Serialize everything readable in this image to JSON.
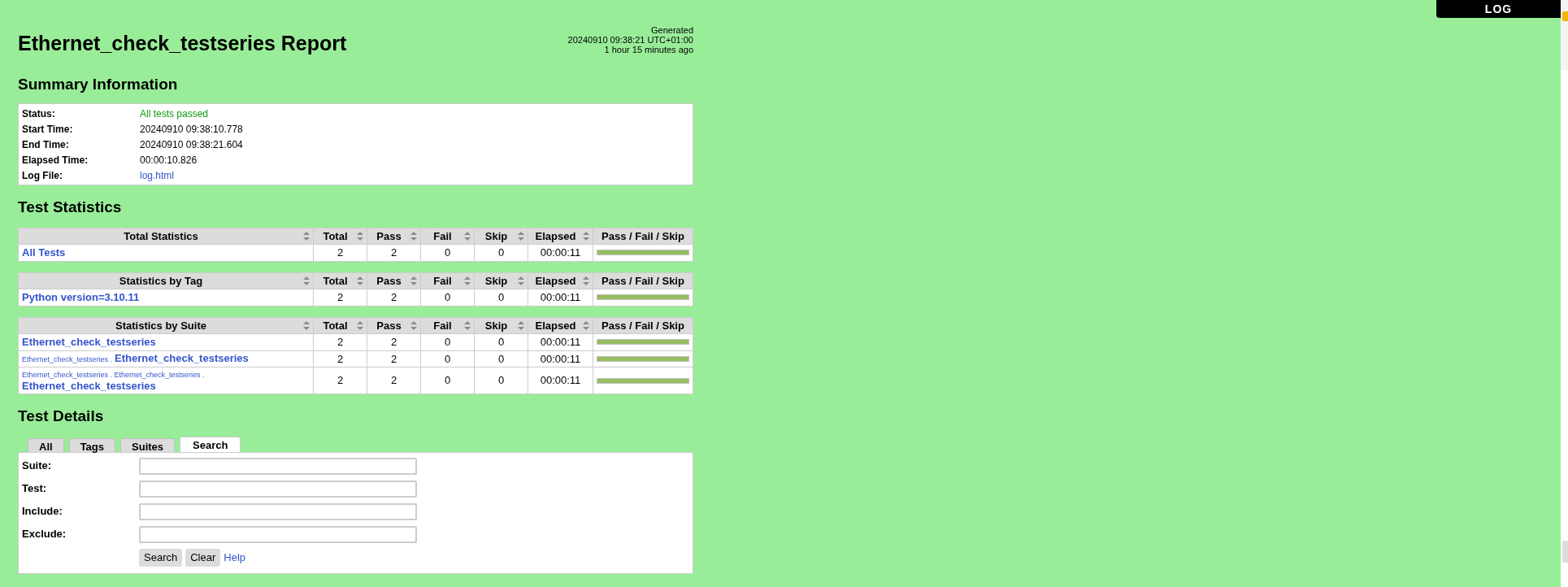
{
  "header": {
    "title": "Ethernet_check_testseries Report",
    "generated": [
      "Generated",
      "20240910 09:38:21 UTC+01:00",
      "1 hour 15 minutes ago"
    ]
  },
  "log_tab": {
    "label": "LOG"
  },
  "summary": {
    "heading": "Summary Information",
    "rows": [
      {
        "label": "Status:",
        "value": "All tests passed",
        "kind": "status"
      },
      {
        "label": "Start Time:",
        "value": "20240910 09:38:10.778",
        "kind": "text"
      },
      {
        "label": "End Time:",
        "value": "20240910 09:38:21.604",
        "kind": "text"
      },
      {
        "label": "Elapsed Time:",
        "value": "00:00:10.826",
        "kind": "text"
      },
      {
        "label": "Log File:",
        "value": "log.html",
        "kind": "link"
      }
    ]
  },
  "statistics": {
    "heading": "Test Statistics",
    "tables": [
      {
        "columns": [
          "Total Statistics",
          "Total",
          "Pass",
          "Fail",
          "Skip",
          "Elapsed",
          "Pass / Fail / Skip"
        ],
        "rows": [
          {
            "name": "All Tests",
            "total": "2",
            "pass": "2",
            "fail": "0",
            "skip": "0",
            "elapsed": "00:00:11",
            "level": 1
          }
        ]
      },
      {
        "columns": [
          "Statistics by Tag",
          "Total",
          "Pass",
          "Fail",
          "Skip",
          "Elapsed",
          "Pass / Fail / Skip"
        ],
        "rows": [
          {
            "name": "Python version=3.10.11",
            "total": "2",
            "pass": "2",
            "fail": "0",
            "skip": "0",
            "elapsed": "00:00:11",
            "level": 1
          }
        ]
      },
      {
        "columns": [
          "Statistics by Suite",
          "Total",
          "Pass",
          "Fail",
          "Skip",
          "Elapsed",
          "Pass / Fail / Skip"
        ],
        "rows": [
          {
            "name": "Ethernet_check_testseries",
            "total": "2",
            "pass": "2",
            "fail": "0",
            "skip": "0",
            "elapsed": "00:00:11",
            "level": 1
          },
          {
            "prefix": "Ethernet_check_testseries .",
            "name": "Ethernet_check_testseries",
            "total": "2",
            "pass": "2",
            "fail": "0",
            "skip": "0",
            "elapsed": "00:00:11",
            "level": 1
          },
          {
            "prefix": "Ethernet_check_testseries . Ethernet_check_testseries .",
            "name": "Ethernet_check_testseries",
            "total": "2",
            "pass": "2",
            "fail": "0",
            "skip": "0",
            "elapsed": "00:00:11",
            "level": 1
          }
        ]
      }
    ]
  },
  "details": {
    "heading": "Test Details",
    "tabs": [
      {
        "label": "All",
        "selected": false
      },
      {
        "label": "Tags",
        "selected": false
      },
      {
        "label": "Suites",
        "selected": false
      },
      {
        "label": "Search",
        "selected": true
      }
    ],
    "fields": [
      {
        "label": "Suite:"
      },
      {
        "label": "Test:"
      },
      {
        "label": "Include:"
      },
      {
        "label": "Exclude:"
      }
    ],
    "buttons": [
      "Search",
      "Clear"
    ],
    "help": "Help"
  }
}
